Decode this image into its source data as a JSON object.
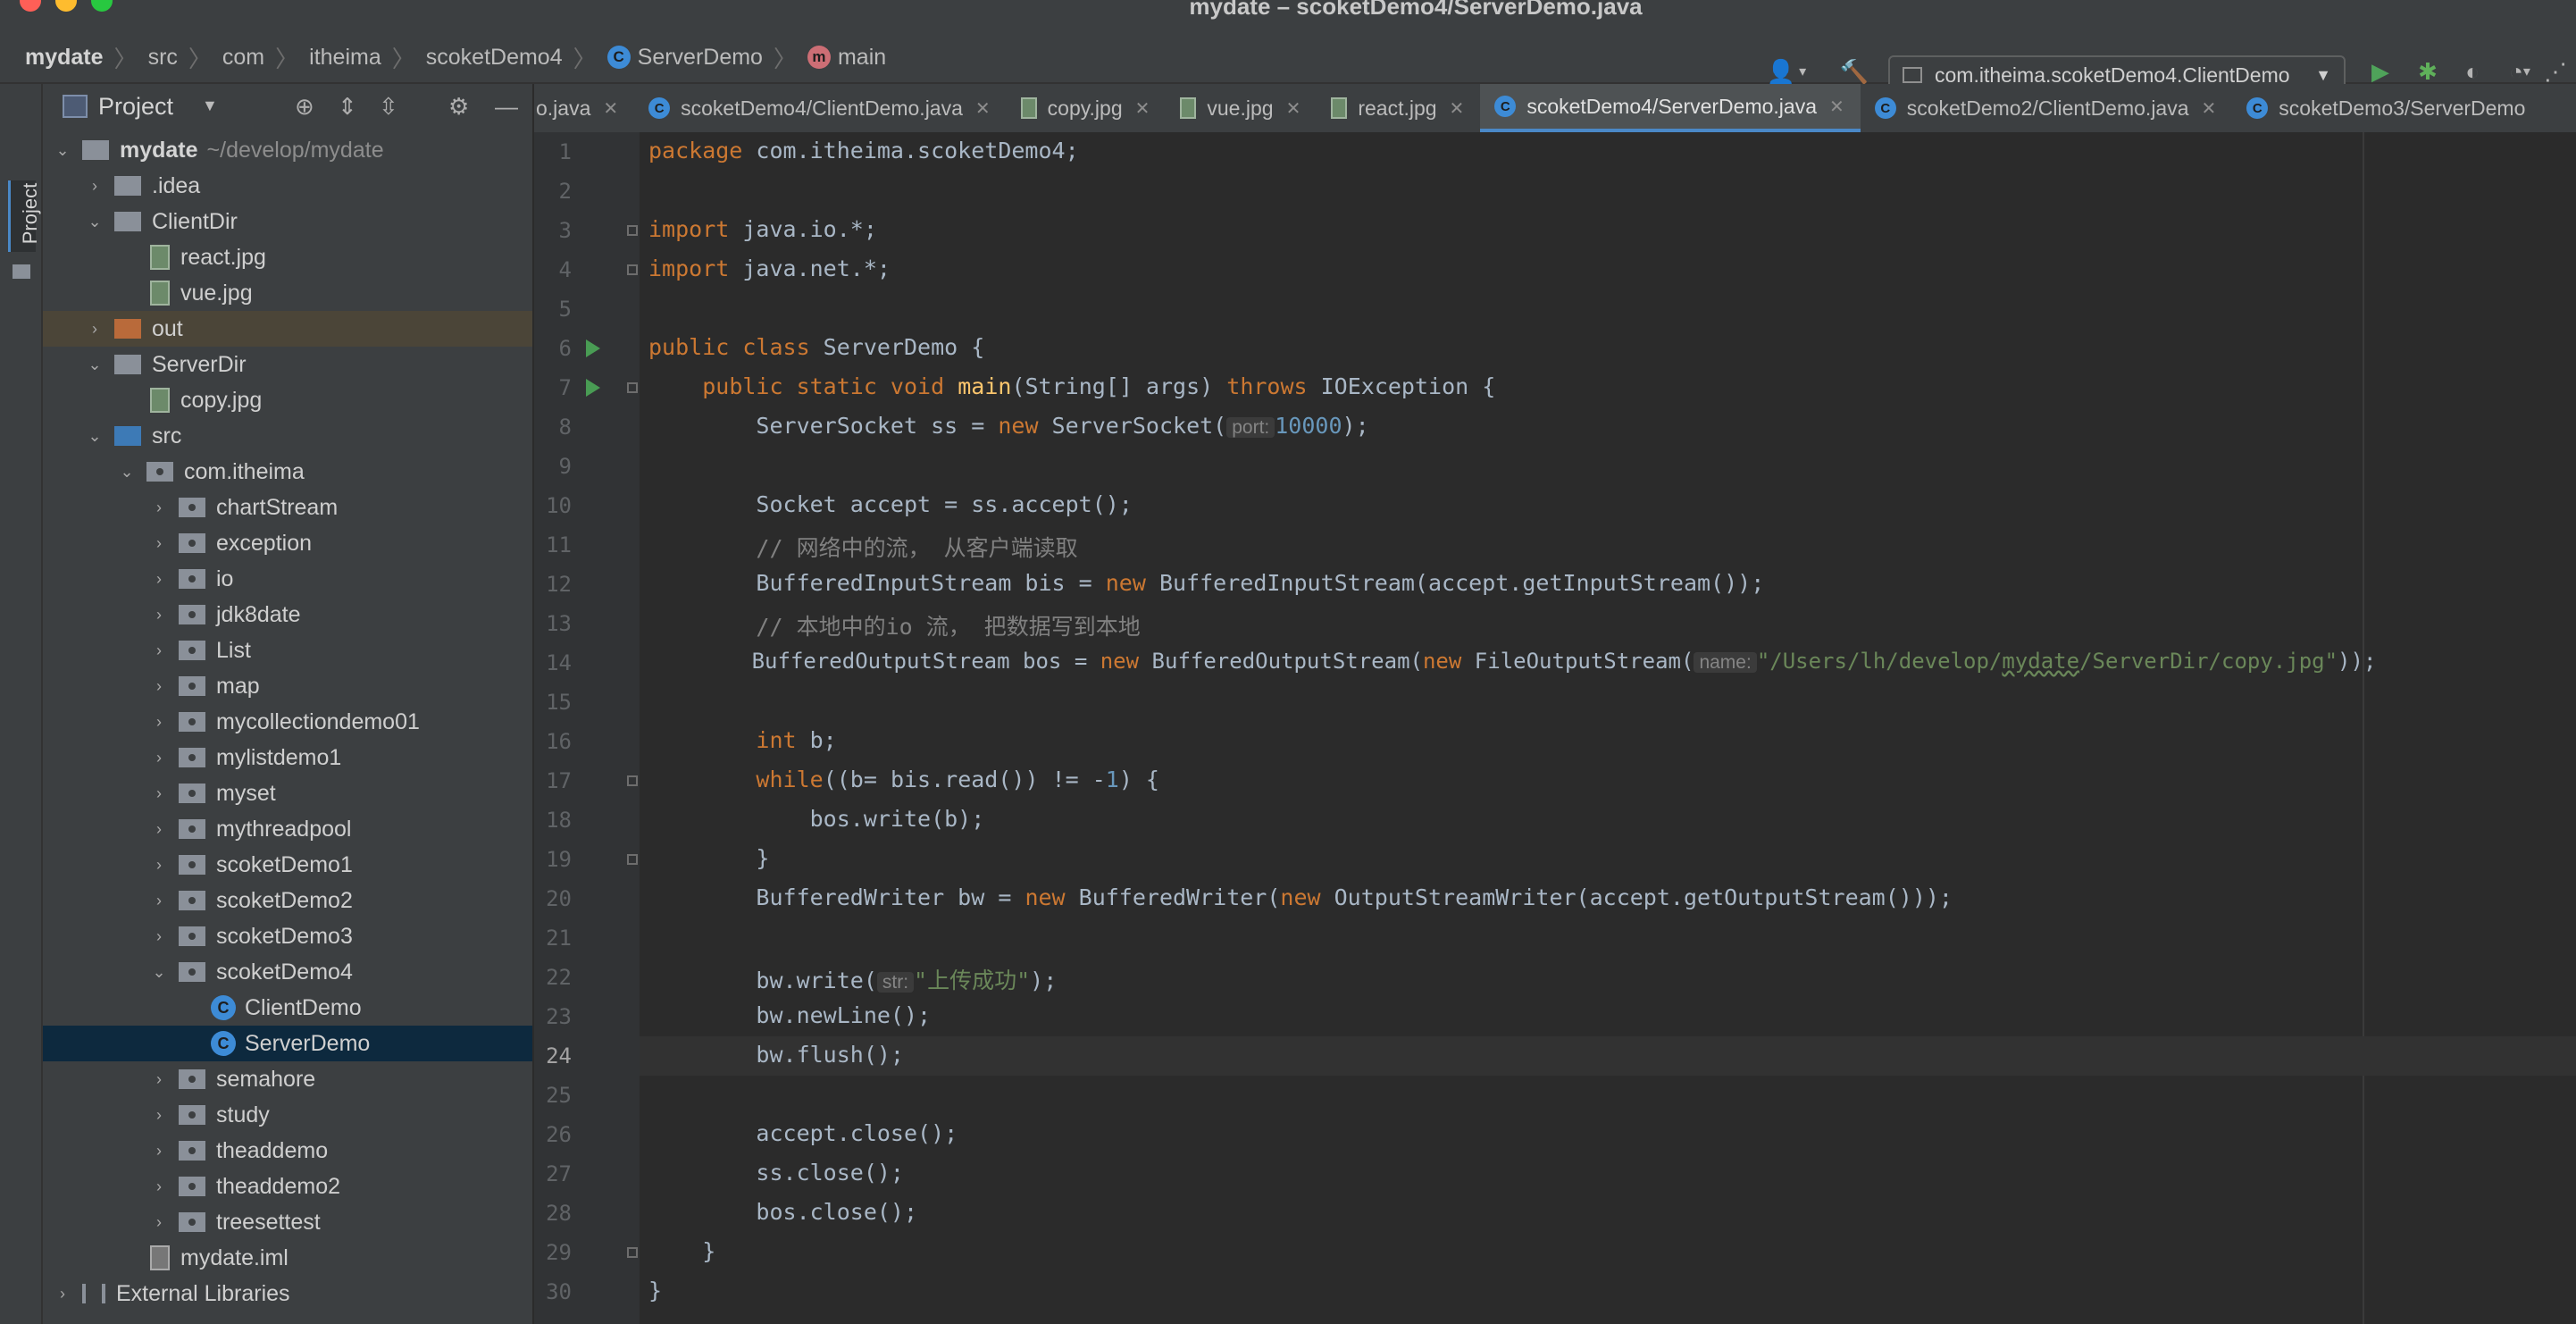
{
  "window": {
    "title": "mydate – scoketDemo4/ServerDemo.java"
  },
  "breadcrumbs": [
    "mydate",
    "src",
    "com",
    "itheima",
    "scoketDemo4",
    "ServerDemo",
    "main"
  ],
  "toolbar": {
    "run_config": "com.itheima.scoketDemo4.ClientDemo"
  },
  "side_strip": {
    "label": "Project"
  },
  "project_panel": {
    "title": "Project",
    "tree": [
      {
        "label": "mydate",
        "suffix": "~/develop/mydate"
      },
      {
        "label": ".idea"
      },
      {
        "label": "ClientDir"
      },
      {
        "label": "react.jpg"
      },
      {
        "label": "vue.jpg"
      },
      {
        "label": "out"
      },
      {
        "label": "ServerDir"
      },
      {
        "label": "copy.jpg"
      },
      {
        "label": "src"
      },
      {
        "label": "com.itheima"
      },
      {
        "label": "chartStream"
      },
      {
        "label": "exception"
      },
      {
        "label": "io"
      },
      {
        "label": "jdk8date"
      },
      {
        "label": "List"
      },
      {
        "label": "map"
      },
      {
        "label": "mycollectiondemo01"
      },
      {
        "label": "mylistdemo1"
      },
      {
        "label": "myset"
      },
      {
        "label": "mythreadpool"
      },
      {
        "label": "scoketDemo1"
      },
      {
        "label": "scoketDemo2"
      },
      {
        "label": "scoketDemo3"
      },
      {
        "label": "scoketDemo4"
      },
      {
        "label": "ClientDemo"
      },
      {
        "label": "ServerDemo"
      },
      {
        "label": "semahore"
      },
      {
        "label": "study"
      },
      {
        "label": "theaddemo"
      },
      {
        "label": "theaddemo2"
      },
      {
        "label": "treesettest"
      },
      {
        "label": "mydate.iml"
      },
      {
        "label": "External Libraries"
      }
    ]
  },
  "tabs": [
    {
      "label": "o.java"
    },
    {
      "label": "scoketDemo4/ClientDemo.java"
    },
    {
      "label": "copy.jpg"
    },
    {
      "label": "vue.jpg"
    },
    {
      "label": "react.jpg"
    },
    {
      "label": "scoketDemo4/ServerDemo.java"
    },
    {
      "label": "scoketDemo2/ClientDemo.java"
    },
    {
      "label": "scoketDemo3/ServerDemo"
    }
  ],
  "editor": {
    "current_line": 24,
    "line_numbers": [
      "1",
      "2",
      "3",
      "4",
      "5",
      "6",
      "7",
      "8",
      "9",
      "10",
      "11",
      "12",
      "13",
      "14",
      "15",
      "16",
      "17",
      "18",
      "19",
      "20",
      "21",
      "22",
      "23",
      "24",
      "25",
      "26",
      "27",
      "28",
      "29",
      "30"
    ],
    "code": {
      "l1_kw": "package",
      "l1_rest": " com.itheima.scoketDemo4;",
      "l3_kw": "import",
      "l3_rest": " java.io.*;",
      "l4_kw": "import",
      "l4_rest": " java.net.*;",
      "l6_kw": "public class",
      "l6_rest": " ServerDemo {",
      "l7_indent": "    ",
      "l7_kw": "public static void",
      "l7_sp": " ",
      "l7_fn": "main",
      "l7_mid": "(String[] args) ",
      "l7_kw2": "throws",
      "l7_rest": " IOException {",
      "l8_pre": "        ServerSocket ss = ",
      "l8_kw": "new",
      "l8_mid": " ServerSocket(",
      "l8_hint": "port:",
      "l8_num": "10000",
      "l8_end": ");",
      "l10_text": "        Socket accept = ss.accept();",
      "l11_indent": "        ",
      "l11_cmt": "// 网络中的流， 从客户端读取",
      "l12_pre": "        BufferedInputStream bis = ",
      "l12_kw": "new",
      "l12_rest": " BufferedInputStream(accept.getInputStream());",
      "l13_indent": "        ",
      "l13_cmt": "// 本地中的io 流， 把数据写到本地",
      "l14_pre": "        BufferedOutputStream bos = ",
      "l14_kw": "new",
      "l14_mid": " BufferedOutputStream(",
      "l14_kw2": "new",
      "l14_mid2": " FileOutputStream(",
      "l14_hint": "name:",
      "l14_str1": "\"/Users/lh/develop/",
      "l14_str2": "mydate",
      "l14_str3": "/ServerDir/copy.jpg\"",
      "l14_end": "));",
      "l16_indent": "        ",
      "l16_kw": "int",
      "l16_rest": " b;",
      "l17_indent": "        ",
      "l17_kw": "while",
      "l17_mid": "((b= bis.read()) != -",
      "l17_num": "1",
      "l17_end": ") {",
      "l18_text": "            bos.write(b);",
      "l19_text": "        }",
      "l20_pre": "        BufferedWriter bw = ",
      "l20_kw": "new",
      "l20_mid": " BufferedWriter(",
      "l20_kw2": "new",
      "l20_rest": " OutputStreamWriter(accept.getOutputStream()));",
      "l22_pre": "        bw.write(",
      "l22_hint": "str:",
      "l22_str": "\"上传成功\"",
      "l22_end": ");",
      "l23_text": "        bw.newLine();",
      "l24_text": "        bw.flush();",
      "l26_text": "        accept.close();",
      "l27_text": "        ss.close();",
      "l28_text": "        bos.close();",
      "l29_text": "    }",
      "l30_text": "}"
    }
  }
}
